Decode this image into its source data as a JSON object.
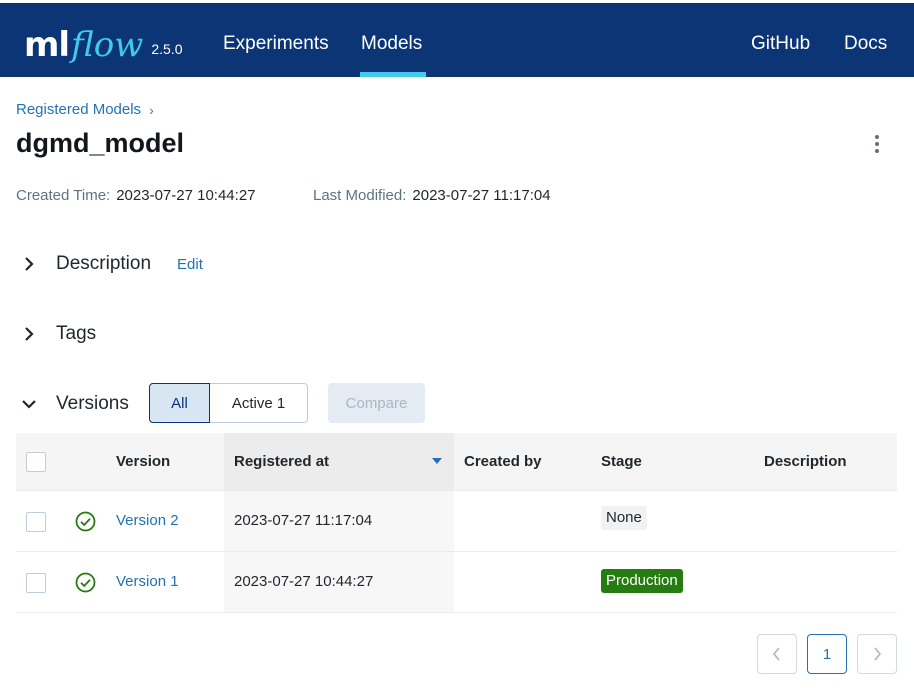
{
  "header": {
    "logo_ml": "ml",
    "logo_flow": "flow",
    "version": "2.5.0",
    "nav": {
      "experiments": "Experiments",
      "models": "Models",
      "github": "GitHub",
      "docs": "Docs"
    },
    "active_nav": "Models",
    "accent_color": "#43c9ed",
    "background_color": "#0b3574"
  },
  "breadcrumb": {
    "registered_models": "Registered Models",
    "separator": "›"
  },
  "model": {
    "name": "dgmd_model",
    "created_time_label": "Created Time:",
    "created_time": "2023-07-27 10:44:27",
    "last_modified_label": "Last Modified:",
    "last_modified": "2023-07-27 11:17:04"
  },
  "sections": {
    "description": {
      "title": "Description",
      "edit": "Edit",
      "expanded": false
    },
    "tags": {
      "title": "Tags",
      "expanded": false
    },
    "versions": {
      "title": "Versions",
      "expanded": true
    }
  },
  "versions_controls": {
    "filter_all": "All",
    "filter_active": "Active 1",
    "selected_filter": "All",
    "compare": "Compare",
    "compare_enabled": false
  },
  "table": {
    "columns": {
      "version": "Version",
      "registered_at": "Registered at",
      "created_by": "Created by",
      "stage": "Stage",
      "description": "Description"
    },
    "sort": {
      "column": "Registered at",
      "direction": "descending"
    },
    "rows": [
      {
        "status_icon": "check-circle-icon",
        "version": "Version 2",
        "registered_at": "2023-07-27 11:17:04",
        "created_by": "",
        "stage": "None",
        "description": ""
      },
      {
        "status_icon": "check-circle-icon",
        "version": "Version 1",
        "registered_at": "2023-07-27 10:44:27",
        "created_by": "",
        "stage": "Production",
        "description": ""
      }
    ]
  },
  "pagination": {
    "prev_icon": "chevron-left-icon",
    "current_page": "1",
    "next_icon": "chevron-right-icon"
  },
  "colors": {
    "link": "#2272b4",
    "success": "#277c11",
    "production_tag": "#277c11"
  }
}
